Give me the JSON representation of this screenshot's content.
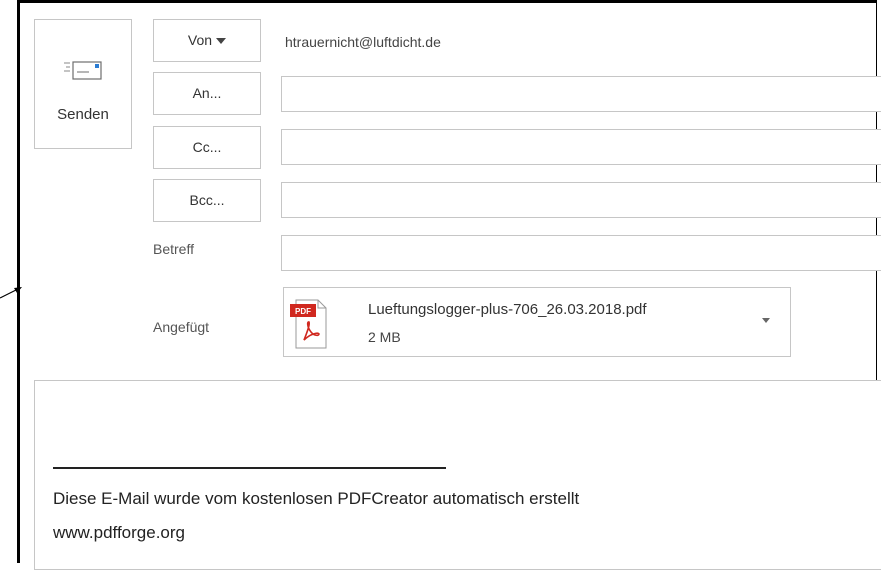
{
  "compose": {
    "send_label": "Senden",
    "from_label": "Von",
    "from_address": "htrauernicht@luftdicht.de",
    "to_label": "An...",
    "cc_label": "Cc...",
    "bcc_label": "Bcc...",
    "subject_label": "Betreff",
    "attached_label": "Angefügt",
    "to_value": "",
    "cc_value": "",
    "bcc_value": "",
    "subject_value": ""
  },
  "attachment": {
    "icon": "pdf-icon",
    "filename": "Lueftungslogger-plus-706_26.03.2018.pdf",
    "size": "2 MB"
  },
  "body": {
    "signature_line1": "Diese E-Mail wurde vom kostenlosen PDFCreator automatisch erstellt",
    "signature_line2": "www.pdfforge.org"
  },
  "colors": {
    "border": "#c6c6c6",
    "pdf_red": "#d0281f",
    "frame": "#000000"
  }
}
